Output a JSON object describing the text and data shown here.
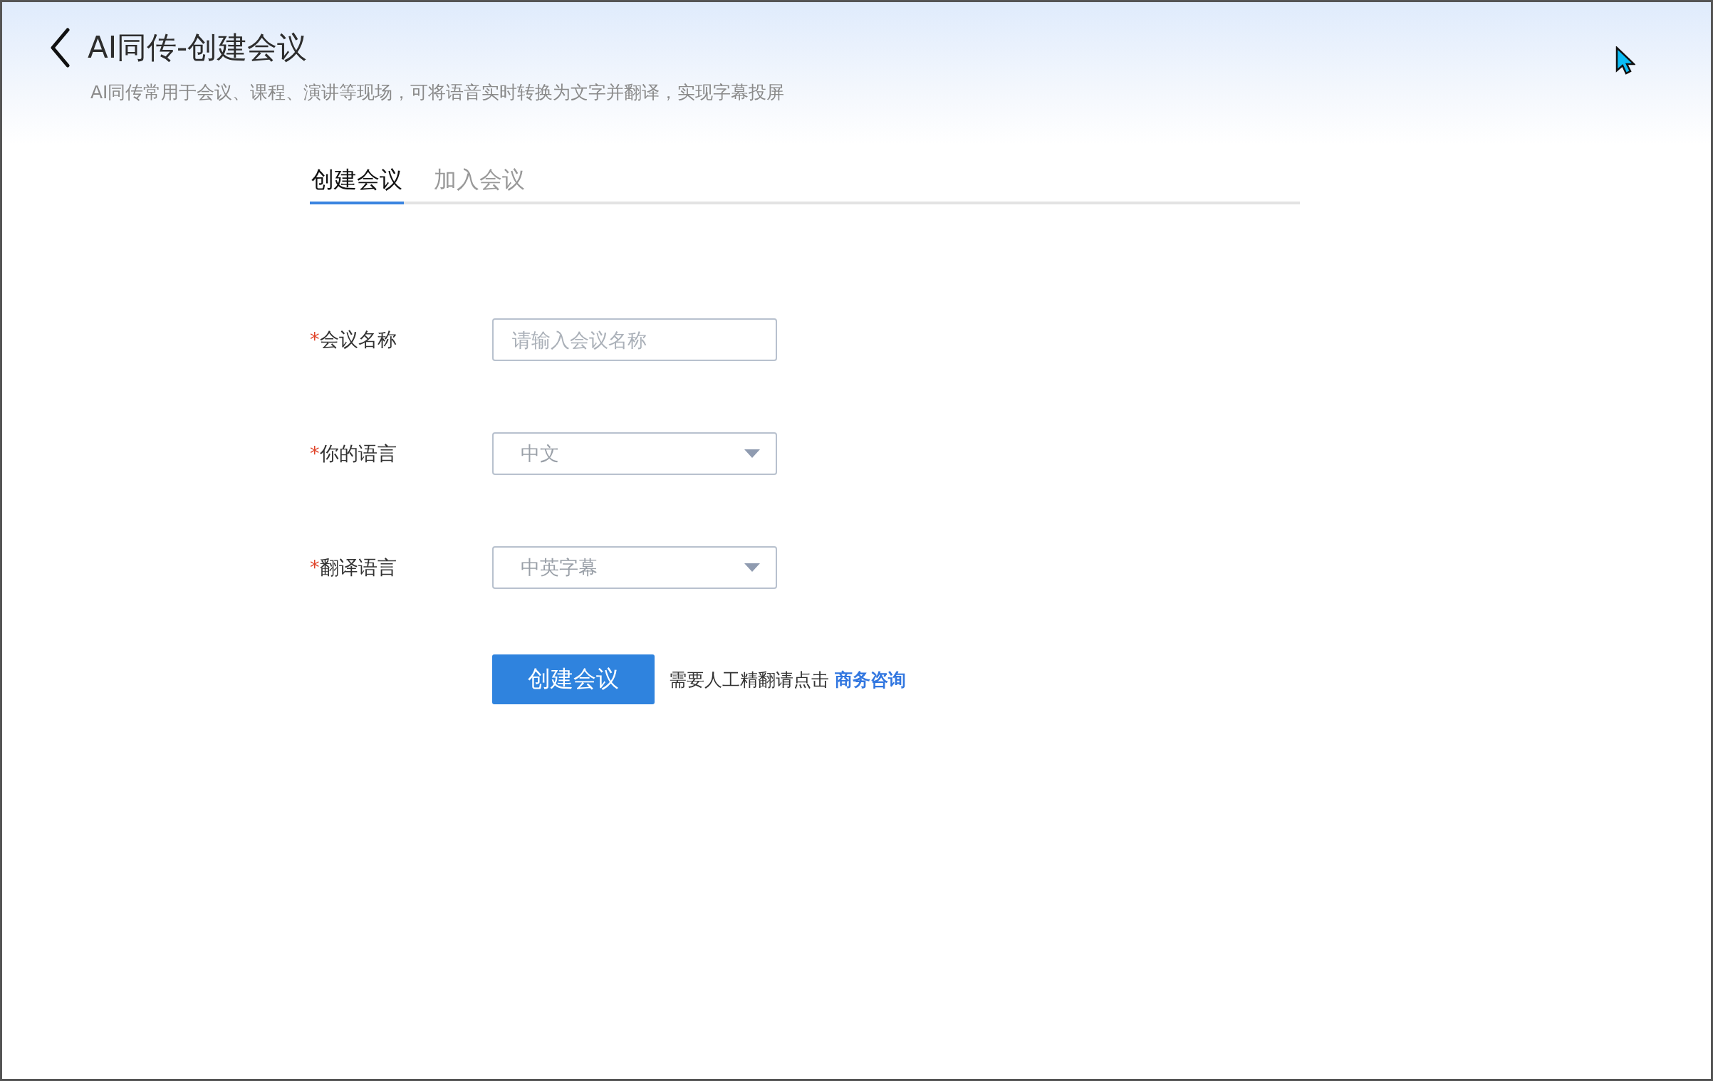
{
  "header": {
    "title": "AI同传-创建会议",
    "subtitle": "AI同传常用于会议、课程、演讲等现场，可将语音实时转换为文字并翻译，实现字幕投屏"
  },
  "tabs": [
    {
      "label": "创建会议",
      "selected": true
    },
    {
      "label": "加入会议",
      "selected": false
    }
  ],
  "form": {
    "fields": [
      {
        "kind": "text",
        "required_mark": "*",
        "label": "会议名称",
        "placeholder": "请输入会议名称"
      },
      {
        "kind": "select",
        "required_mark": "*",
        "label": "你的语言",
        "value": "中文"
      },
      {
        "kind": "select",
        "required_mark": "*",
        "label": "翻译语言",
        "value": "中英字幕"
      }
    ],
    "submit": "创建会议",
    "note": "需要人工精翻请点击",
    "link": "商务咨询"
  }
}
